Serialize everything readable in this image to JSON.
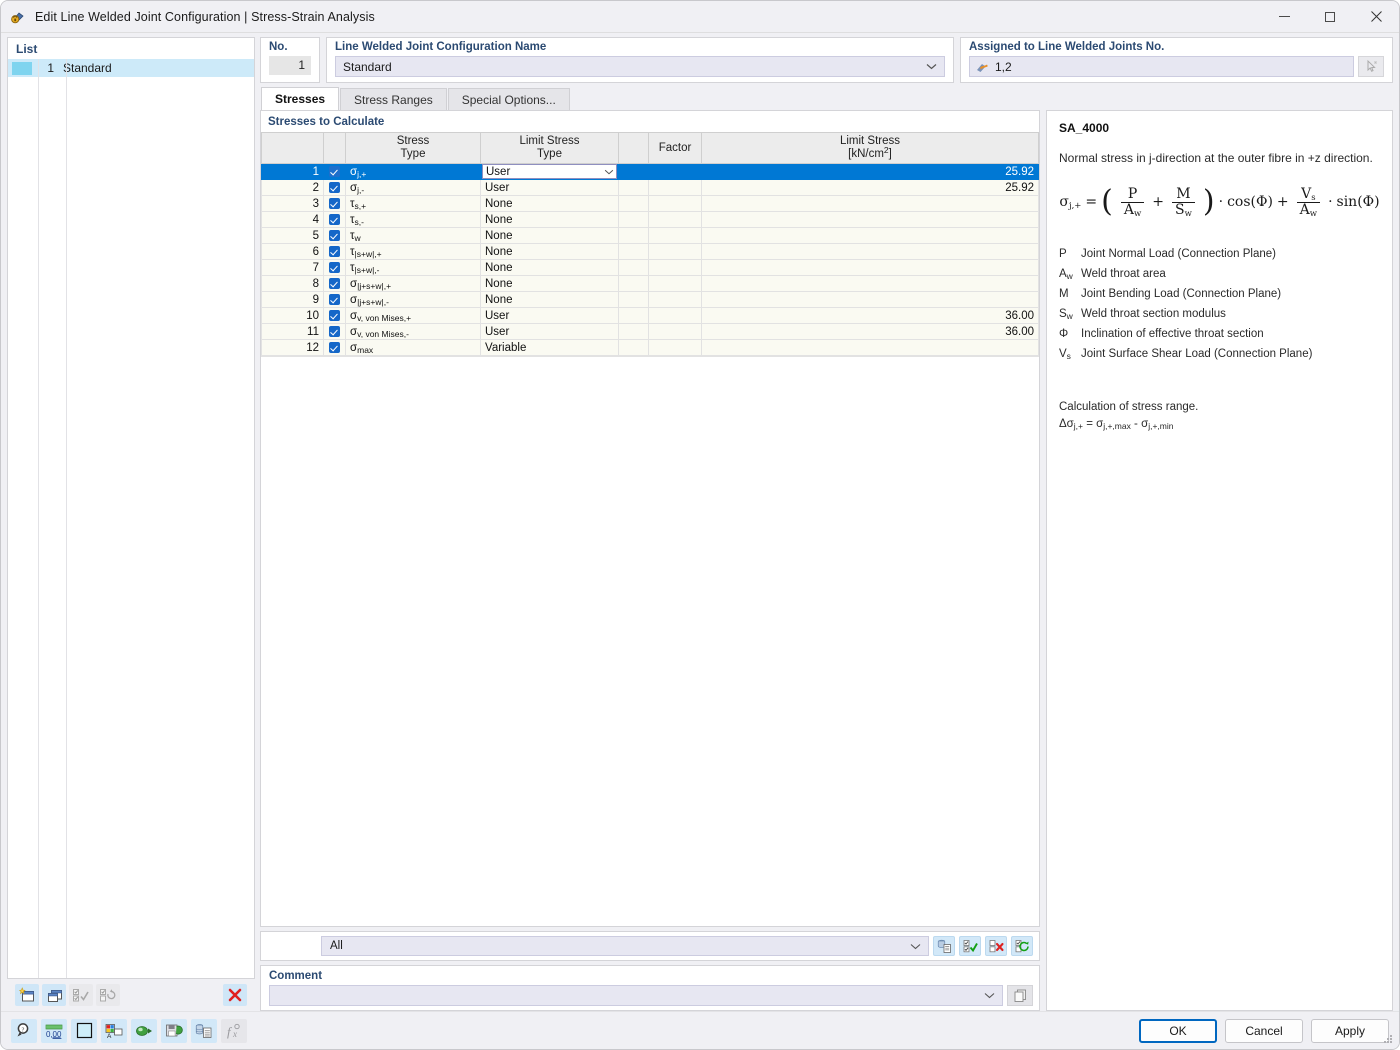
{
  "window": {
    "title": "Edit Line Welded Joint Configuration | Stress-Strain Analysis",
    "icon": "welded-joint-icon",
    "minimize": "minimize-icon",
    "maximize": "maximize-icon",
    "close": "close-icon"
  },
  "list": {
    "header": "List",
    "rows": [
      {
        "num": "1",
        "name": "Standard",
        "selected": true
      }
    ],
    "toolbar": [
      {
        "name": "new-configuration-button",
        "enabled": true
      },
      {
        "name": "copy-configuration-button",
        "enabled": true
      },
      {
        "name": "select-all-button",
        "enabled": false
      },
      {
        "name": "invert-selection-button",
        "enabled": false
      },
      {
        "name": "delete-configuration-button",
        "enabled": true,
        "glyph": "✕"
      }
    ]
  },
  "header_fields": {
    "no_label": "No.",
    "no_value": "1",
    "name_label": "Line Welded Joint Configuration Name",
    "name_value": "Standard",
    "assigned_label": "Assigned to Line Welded Joints No.",
    "assigned_value": "1,2",
    "pick_button": "pick-objects-icon"
  },
  "tabs": [
    {
      "label": "Stresses",
      "active": true
    },
    {
      "label": "Stress Ranges",
      "active": false
    },
    {
      "label": "Special Options...",
      "active": false
    }
  ],
  "grid": {
    "title": "Stresses to Calculate",
    "columns": {
      "row_no": "",
      "check": "",
      "stress_type": "Stress\nType",
      "stress_type_l1": "Stress",
      "stress_type_l2": "Type",
      "limit_stress_type_l1": "Limit Stress",
      "limit_stress_type_l2": "Type",
      "narrow": "",
      "factor": "Factor",
      "limit_stress_l1": "Limit Stress",
      "limit_stress_l2": "[kN/cm2]",
      "limit_stress_unit_base": "[kN/cm",
      "limit_stress_unit_sup": "2",
      "limit_stress_unit_end": "]"
    },
    "rows": [
      {
        "no": "1",
        "checked": true,
        "sym": "σ",
        "sub": "j,+",
        "limit_type": "User",
        "factor": "",
        "limit_stress": "25.92",
        "selected": true,
        "editable": true
      },
      {
        "no": "2",
        "checked": true,
        "sym": "σ",
        "sub": "j,-",
        "limit_type": "User",
        "factor": "",
        "limit_stress": "25.92",
        "selected": false,
        "editable": true
      },
      {
        "no": "3",
        "checked": true,
        "sym": "τ",
        "sub": "s,+",
        "limit_type": "None",
        "factor": "",
        "limit_stress": "",
        "selected": false,
        "editable": false
      },
      {
        "no": "4",
        "checked": true,
        "sym": "τ",
        "sub": "s,-",
        "limit_type": "None",
        "factor": "",
        "limit_stress": "",
        "selected": false,
        "editable": false
      },
      {
        "no": "5",
        "checked": true,
        "sym": "τ",
        "sub": "w",
        "limit_type": "None",
        "factor": "",
        "limit_stress": "",
        "selected": false,
        "editable": false
      },
      {
        "no": "6",
        "checked": true,
        "sym": "τ",
        "sub": "|s+w|,+",
        "limit_type": "None",
        "factor": "",
        "limit_stress": "",
        "selected": false,
        "editable": false
      },
      {
        "no": "7",
        "checked": true,
        "sym": "τ",
        "sub": "|s+w|,-",
        "limit_type": "None",
        "factor": "",
        "limit_stress": "",
        "selected": false,
        "editable": false
      },
      {
        "no": "8",
        "checked": true,
        "sym": "σ",
        "sub": "|j+s+w|,+",
        "limit_type": "None",
        "factor": "",
        "limit_stress": "",
        "selected": false,
        "editable": false
      },
      {
        "no": "9",
        "checked": true,
        "sym": "σ",
        "sub": "|j+s+w|,-",
        "limit_type": "None",
        "factor": "",
        "limit_stress": "",
        "selected": false,
        "editable": false
      },
      {
        "no": "10",
        "checked": true,
        "sym": "σ",
        "sub": "v, von Mises,+",
        "limit_type": "User",
        "factor": "",
        "limit_stress": "36.00",
        "selected": false,
        "editable": true
      },
      {
        "no": "11",
        "checked": true,
        "sym": "σ",
        "sub": "v, von Mises,-",
        "limit_type": "User",
        "factor": "",
        "limit_stress": "36.00",
        "selected": false,
        "editable": true
      },
      {
        "no": "12",
        "checked": true,
        "sym": "σ",
        "sub": "max",
        "limit_type": "Variable",
        "factor": "",
        "limit_stress": "",
        "selected": false,
        "editable": false
      }
    ]
  },
  "filter": {
    "value": "All",
    "buttons": [
      {
        "name": "import-from-library-button"
      },
      {
        "name": "check-all-button"
      },
      {
        "name": "uncheck-all-button"
      },
      {
        "name": "reset-selection-button"
      }
    ]
  },
  "comment": {
    "label": "Comment",
    "value": "",
    "copy_button": "copy-comment-icon"
  },
  "info": {
    "code": "SA_4000",
    "description": "Normal stress in j-direction at the outer fibre in +z direction.",
    "formula": {
      "lhs_sym": "σ",
      "lhs_sub": "j,+",
      "equals": "=",
      "open_paren": "(",
      "f1_num": "P",
      "f1_den_base": "A",
      "f1_den_sub": "w",
      "plus1": "+",
      "f2_num": "M",
      "f2_den_base": "S",
      "f2_den_sub": "w",
      "close_paren": ")",
      "dot1": "·",
      "cos": "cos(Φ)",
      "plus2": "+",
      "f3_num_base": "V",
      "f3_num_sub": "s",
      "f3_den_base": "A",
      "f3_den_sub": "w",
      "dot2": "·",
      "sin": "sin(Φ)"
    },
    "legend": [
      {
        "sym_base": "P",
        "sym_sub": "",
        "text": "Joint Normal Load (Connection Plane)"
      },
      {
        "sym_base": "A",
        "sym_sub": "w",
        "text": "Weld throat area"
      },
      {
        "sym_base": "M",
        "sym_sub": "",
        "text": "Joint Bending Load (Connection Plane)"
      },
      {
        "sym_base": "S",
        "sym_sub": "w",
        "text": "Weld throat section modulus"
      },
      {
        "sym_base": "Φ",
        "sym_sub": "",
        "text": "Inclination of effective throat section"
      },
      {
        "sym_base": "V",
        "sym_sub": "s",
        "text": "Joint Surface Shear Load (Connection Plane)"
      }
    ],
    "stress_range_title": "Calculation of stress range.",
    "stress_range_formula_delta": "Δσ",
    "stress_range_sub1": "j,+",
    "stress_range_eq": " = σ",
    "stress_range_sub2": "j,+,max",
    "stress_range_minus": " - σ",
    "stress_range_sub3": "j,+,min"
  },
  "bottom_toolbar": [
    {
      "name": "search-tool-button"
    },
    {
      "name": "number-format-button"
    },
    {
      "name": "color-swatch-button"
    },
    {
      "name": "display-properties-button"
    },
    {
      "name": "render-mode-button"
    },
    {
      "name": "save-view-button"
    },
    {
      "name": "table-export-button"
    },
    {
      "name": "formula-editor-button",
      "disabled": true
    }
  ],
  "actions": {
    "ok": "OK",
    "cancel": "Cancel",
    "apply": "Apply"
  },
  "colors": {
    "accent_blue": "#0078d4",
    "label_blue": "#2b4a72",
    "selection_list": "#cdeaf9",
    "field_bg": "#e7e7f2",
    "row_alt": "#fafaf2",
    "toolbar_btn": "#d2e8f8",
    "delete_red": "#e02020"
  }
}
